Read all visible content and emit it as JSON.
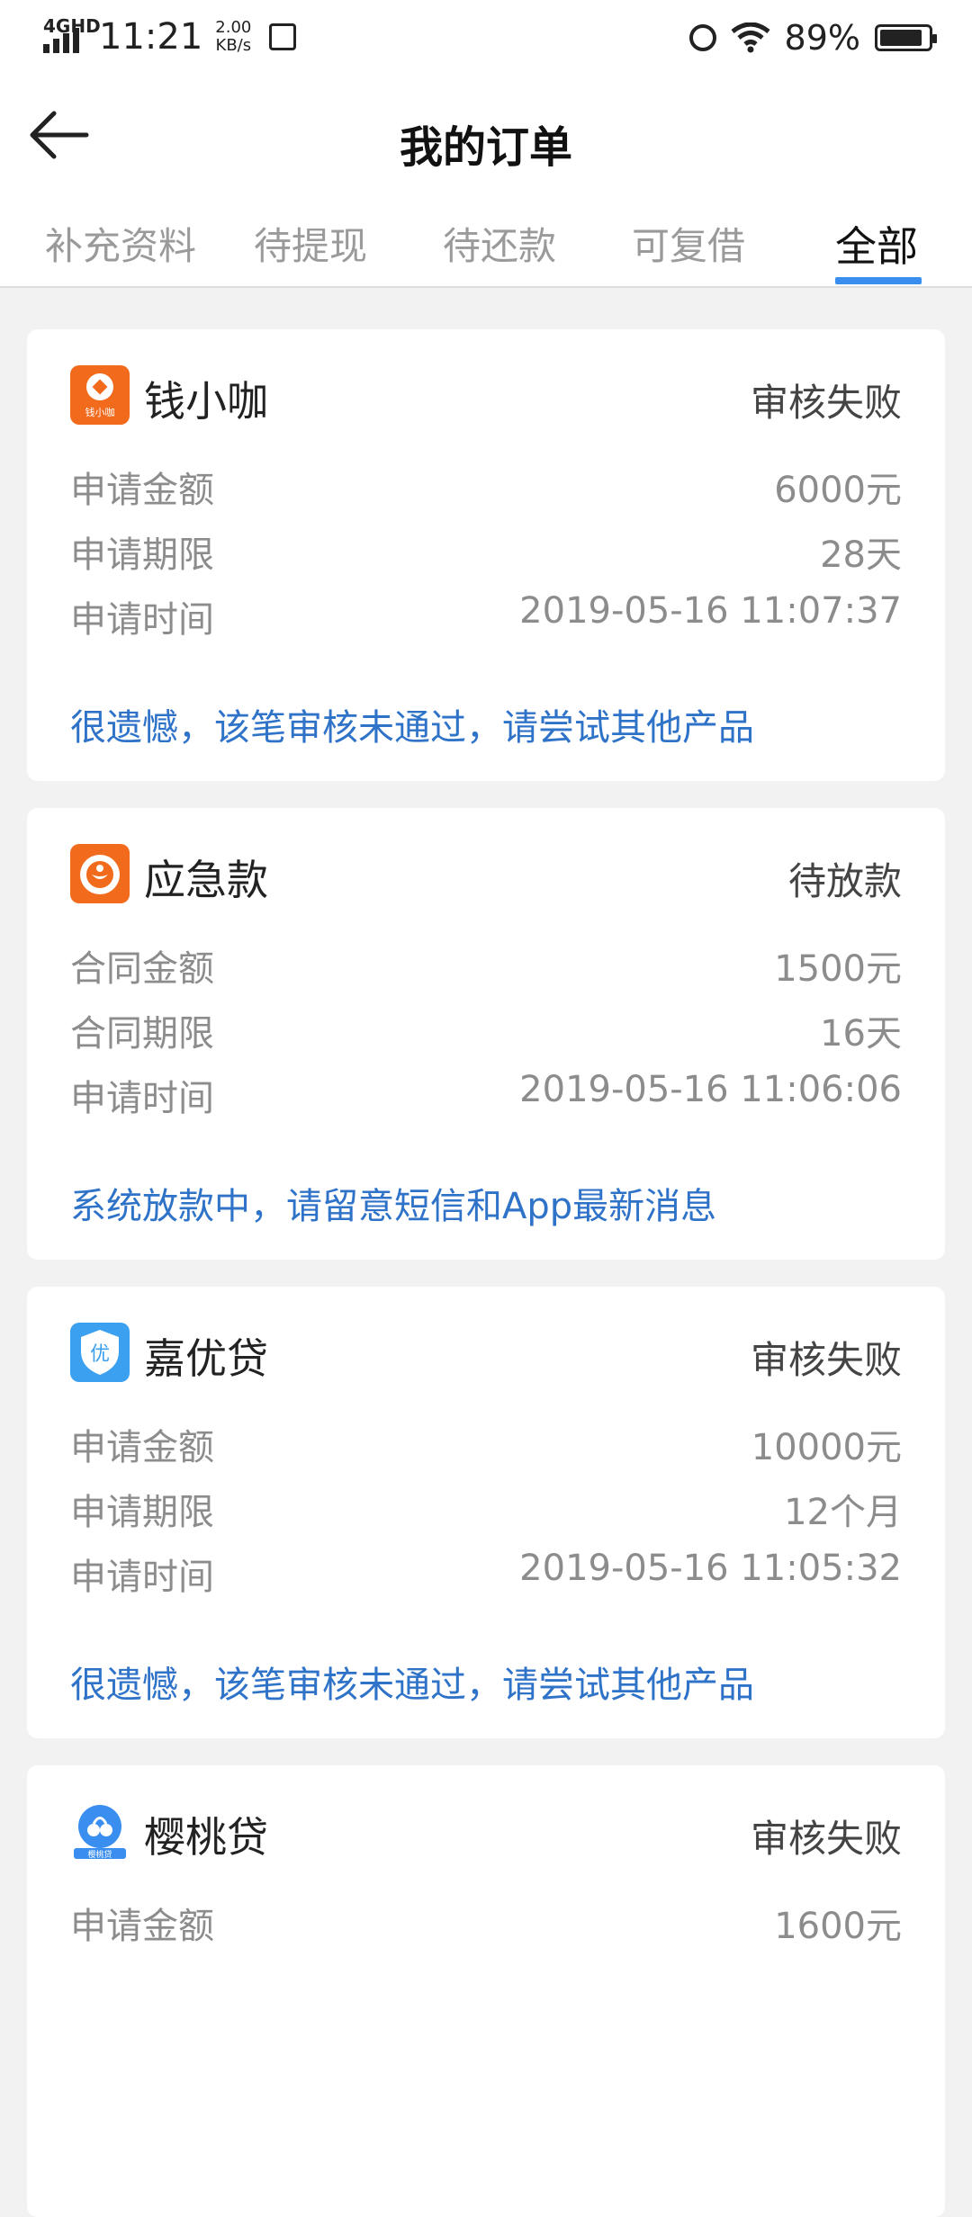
{
  "status_bar": {
    "network": "4GHD",
    "time": "11:21",
    "speed_value": "2.00",
    "speed_unit": "KB/s",
    "battery_percent": "89%",
    "battery_level": 0.89
  },
  "header": {
    "title": "我的订单"
  },
  "tabs": [
    {
      "label": "补充资料",
      "active": false
    },
    {
      "label": "待提现",
      "active": false
    },
    {
      "label": "待还款",
      "active": false
    },
    {
      "label": "可复借",
      "active": false
    },
    {
      "label": "全部",
      "active": true
    }
  ],
  "orders": [
    {
      "name": "钱小咖",
      "logo_text": "钱小咖",
      "status": "审核失败",
      "rows": [
        {
          "k": "申请金额",
          "v": "6000元"
        },
        {
          "k": "申请期限",
          "v": "28天"
        },
        {
          "k": "申请时间",
          "v": "2019-05-16 11:07:37"
        }
      ],
      "message": "很遗憾，该笔审核未通过，请尝试其他产品"
    },
    {
      "name": "应急款",
      "status": "待放款",
      "rows": [
        {
          "k": "合同金额",
          "v": "1500元"
        },
        {
          "k": "合同期限",
          "v": "16天"
        },
        {
          "k": "申请时间",
          "v": "2019-05-16 11:06:06"
        }
      ],
      "message": "系统放款中，请留意短信和App最新消息"
    },
    {
      "name": "嘉优贷",
      "logo_text": "优",
      "status": "审核失败",
      "rows": [
        {
          "k": "申请金额",
          "v": "10000元"
        },
        {
          "k": "申请期限",
          "v": "12个月"
        },
        {
          "k": "申请时间",
          "v": "2019-05-16 11:05:32"
        }
      ],
      "message": "很遗憾，该笔审核未通过，请尝试其他产品"
    },
    {
      "name": "樱桃贷",
      "logo_text": "樱桃贷",
      "status": "审核失败",
      "rows": [
        {
          "k": "申请金额",
          "v": "1600元"
        }
      ]
    }
  ],
  "colors": {
    "accent": "#3a8ef0",
    "message": "#2f73c9",
    "logo_orange": "#f26b1d",
    "logo_blue": "#3aa0ef"
  }
}
